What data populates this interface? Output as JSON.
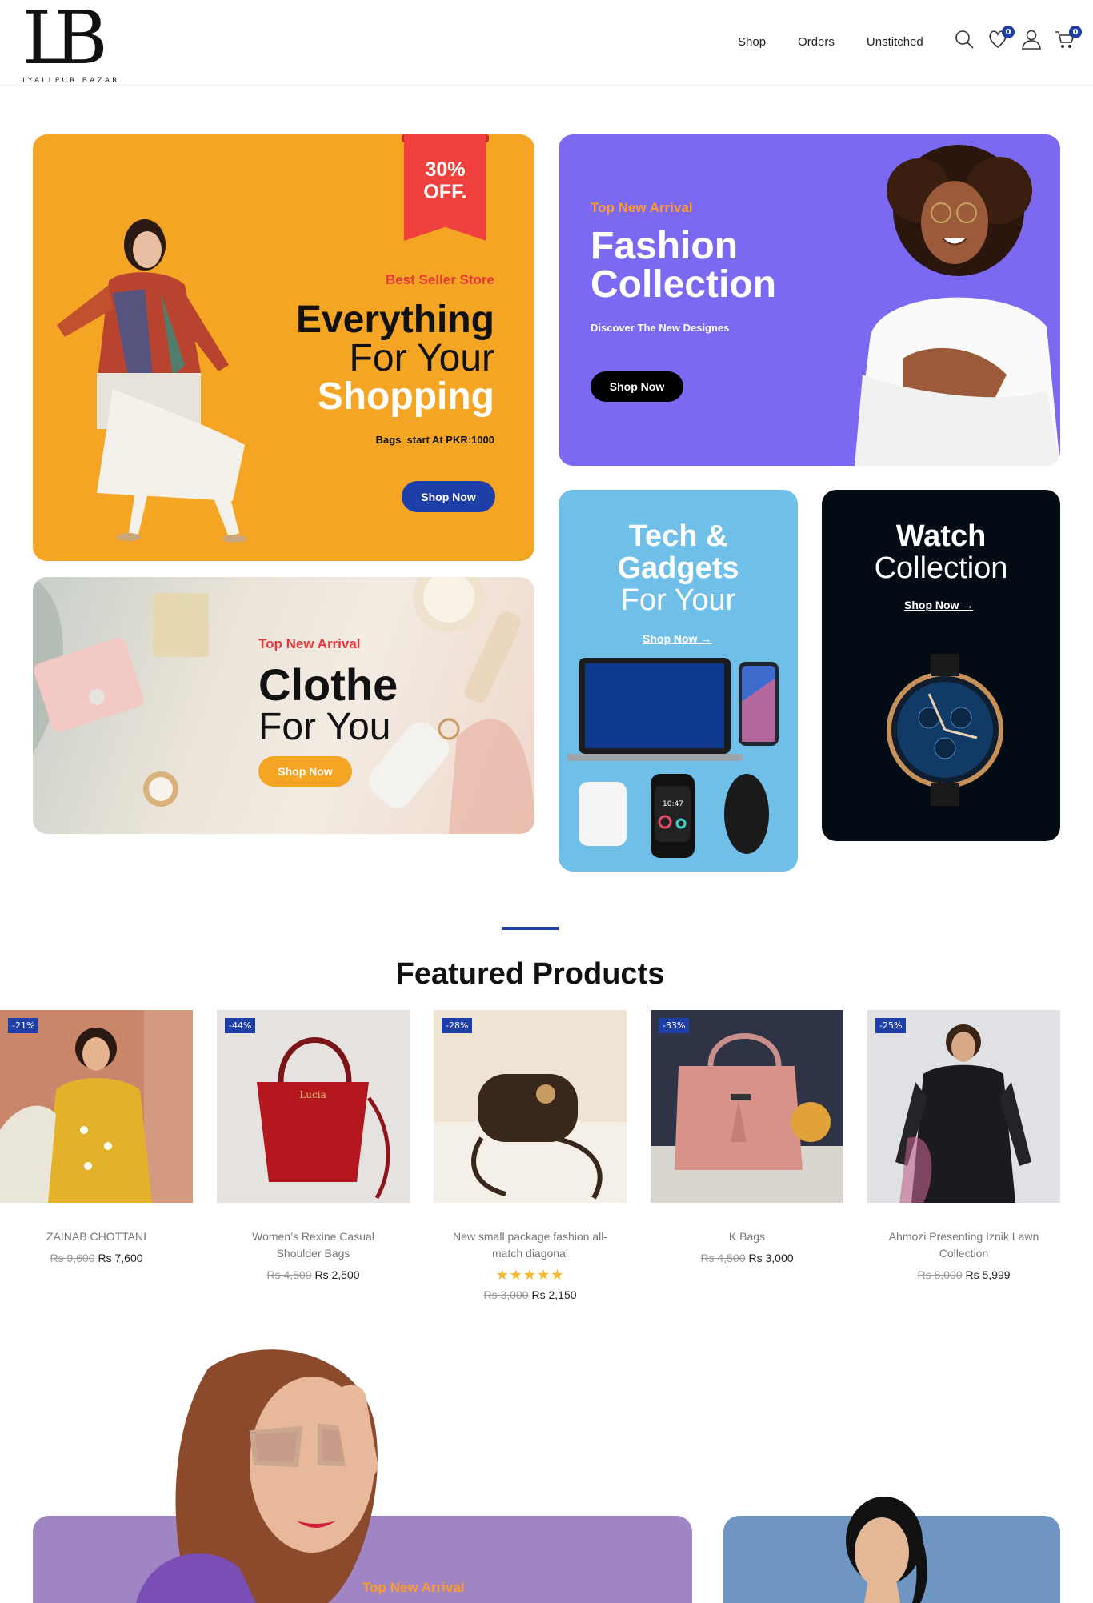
{
  "header": {
    "logo_mark": "LB",
    "logo_sub": "LYALLPUR BAZAR",
    "nav": [
      "Shop",
      "Orders",
      "Unstitched"
    ],
    "wishlist_count": "0",
    "cart_count": "0"
  },
  "banner1": {
    "ribbon_line1": "30%",
    "ribbon_line2": "OFF.",
    "tag": "Best Seller Store",
    "line1": "Everything",
    "line2": "For Your",
    "line3": "Shopping",
    "sub": "Bags  start At PKR:1000",
    "button": "Shop Now"
  },
  "banner2": {
    "tag": "Top New Arrival",
    "line1": "Fashion",
    "line2": "Collection",
    "sub": "Discover The New Designes",
    "button": "Shop Now"
  },
  "banner3": {
    "tag": "Top New Arrival",
    "line1": "Clothe",
    "line2": "For You",
    "button": "Shop Now"
  },
  "banner4": {
    "line1": "Tech &",
    "line2": "Gadgets",
    "line3": "For Your",
    "link": "Shop Now",
    "watch_time": "10:47"
  },
  "banner5": {
    "line1": "Watch",
    "line2": "Collection",
    "link": "Shop Now"
  },
  "featured": {
    "title": "Featured Products",
    "products": [
      {
        "discount": "-21%",
        "name": "ZAINAB CHOTTANI",
        "old": "Rs 9,600",
        "new": "Rs 7,600"
      },
      {
        "discount": "-44%",
        "name": "Women’s Rexine Casual Shoulder Bags",
        "old": "Rs 4,500",
        "new": "Rs 2,500"
      },
      {
        "discount": "-28%",
        "name": "New small package fashion all-match diagonal",
        "old": "Rs 3,000",
        "new": "Rs 2,150",
        "stars": "★★★★★"
      },
      {
        "discount": "-33%",
        "name": "K Bags",
        "old": "Rs 4,500",
        "new": "Rs 3,000"
      },
      {
        "discount": "-25%",
        "name": "Ahmozi Presenting Iznik Lawn Collection",
        "old": "Rs 8,000",
        "new": "Rs 5,999"
      }
    ]
  },
  "bottom": {
    "tag": "Top New Arrival"
  },
  "colors": {
    "accent": "#1f3fa8",
    "orange": "#f5a524",
    "purple": "#7b69f2",
    "sky": "#6fbfe8",
    "red": "#e8393a"
  }
}
